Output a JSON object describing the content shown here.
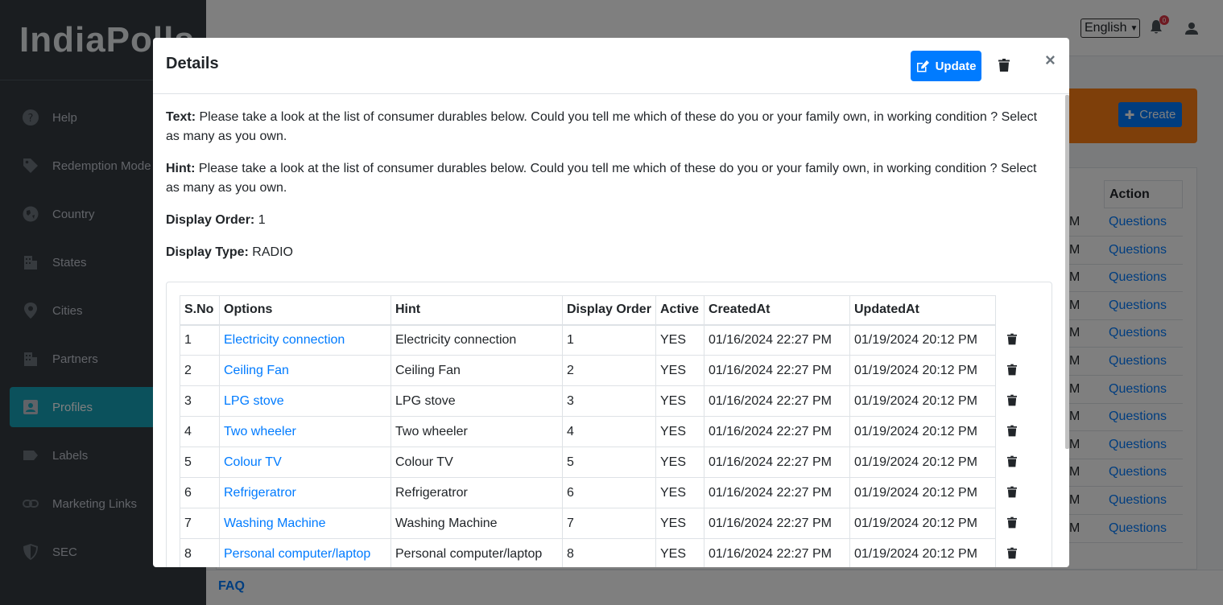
{
  "brand": {
    "name": "IndiaPolls"
  },
  "sidebar": {
    "items": [
      {
        "label": "Help",
        "icon": "help-circle-icon"
      },
      {
        "label": "Redemption Mode",
        "icon": "tag-icon"
      },
      {
        "label": "Country",
        "icon": "globe-icon"
      },
      {
        "label": "States",
        "icon": "building-icon"
      },
      {
        "label": "Cities",
        "icon": "map-pin-icon"
      },
      {
        "label": "Partners",
        "icon": "building-icon"
      },
      {
        "label": "Profiles",
        "icon": "id-card-icon",
        "active": true
      },
      {
        "label": "Labels",
        "icon": "label-icon"
      },
      {
        "label": "Marketing Links",
        "icon": "link-icon"
      },
      {
        "label": "SEC",
        "icon": "shield-icon"
      }
    ]
  },
  "header": {
    "language": "English",
    "notification_count": "0"
  },
  "background": {
    "create_label": "Create",
    "action_header": "Action",
    "row_link": "Questions",
    "row_partial": "M",
    "faq": "FAQ"
  },
  "modal": {
    "title": "Details",
    "update_label": "Update",
    "close_label": "×",
    "fields": [
      {
        "label": "Text:",
        "value": "Please take a look at the list of consumer durables below. Could you tell me which of these do you or your family own, in working condition ? Select as many as you own."
      },
      {
        "label": "Hint:",
        "value": "Please take a look at the list of consumer durables below. Could you tell me which of these do you or your family own, in working condition ? Select as many as you own."
      },
      {
        "label": "Display Order:",
        "value": "1"
      },
      {
        "label": "Display Type:",
        "value": "RADIO"
      }
    ],
    "table": {
      "headers": [
        "S.No",
        "Options",
        "Hint",
        "Display Order",
        "Active",
        "CreatedAt",
        "UpdatedAt"
      ],
      "rows": [
        [
          "1",
          "Electricity connection",
          "Electricity connection",
          "1",
          "YES",
          "01/16/2024 22:27 PM",
          "01/19/2024 20:12 PM"
        ],
        [
          "2",
          "Ceiling Fan",
          "Ceiling Fan",
          "2",
          "YES",
          "01/16/2024 22:27 PM",
          "01/19/2024 20:12 PM"
        ],
        [
          "3",
          "LPG stove",
          "LPG stove",
          "3",
          "YES",
          "01/16/2024 22:27 PM",
          "01/19/2024 20:12 PM"
        ],
        [
          "4",
          "Two wheeler",
          "Two wheeler",
          "4",
          "YES",
          "01/16/2024 22:27 PM",
          "01/19/2024 20:12 PM"
        ],
        [
          "5",
          "Colour TV",
          "Colour TV",
          "5",
          "YES",
          "01/16/2024 22:27 PM",
          "01/19/2024 20:12 PM"
        ],
        [
          "6",
          "Refrigeratror",
          "Refrigeratror",
          "6",
          "YES",
          "01/16/2024 22:27 PM",
          "01/19/2024 20:12 PM"
        ],
        [
          "7",
          "Washing Machine",
          "Washing Machine",
          "7",
          "YES",
          "01/16/2024 22:27 PM",
          "01/19/2024 20:12 PM"
        ],
        [
          "8",
          "Personal computer/laptop",
          "Personal computer/laptop",
          "8",
          "YES",
          "01/16/2024 22:27 PM",
          "01/19/2024 20:12 PM"
        ]
      ]
    }
  }
}
